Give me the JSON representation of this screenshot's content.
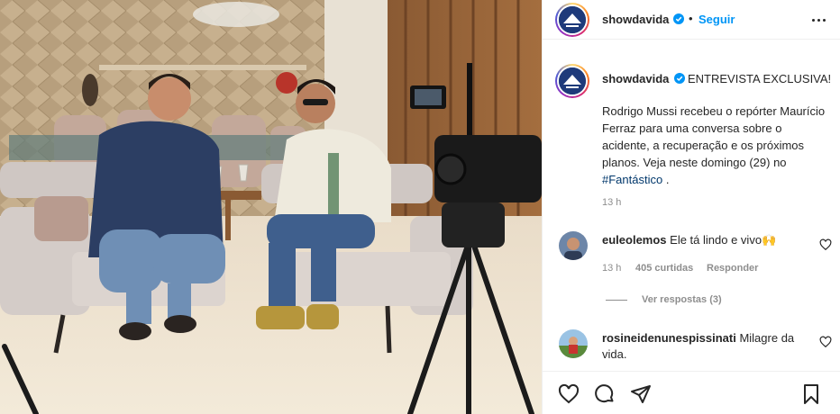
{
  "post": {
    "author": "showdavida",
    "follow_label": "Seguir",
    "dot": "•",
    "caption_headline": "ENTREVISTA EXCLUSIVA!",
    "caption_text": "Rodrigo Mussi recebeu o repórter Maurício Ferraz para uma conversa sobre o acidente, a recuperação e os próximos planos. Veja neste domingo (29) no ",
    "caption_hashtag": "#Fantástico",
    "caption_tail": " .",
    "time": "13 h"
  },
  "comments": [
    {
      "user": "euleolemos",
      "text": "Ele tá lindo e vivo🙌",
      "time": "13 h",
      "likes": "405 curtidas",
      "reply_label": "Responder",
      "view_replies": "Ver respostas (3)"
    },
    {
      "user": "rosineidenunespissinati",
      "text": "Milagre da vida."
    }
  ],
  "icons": {
    "more": "more-options-icon",
    "verified": "verified-badge-icon",
    "like": "heart-icon",
    "comment": "comment-icon",
    "share": "share-icon",
    "save": "bookmark-icon"
  },
  "colors": {
    "link": "#0095f6",
    "hashtag": "#00376b",
    "muted": "#8e8e8e",
    "verified": "#0095f6"
  }
}
